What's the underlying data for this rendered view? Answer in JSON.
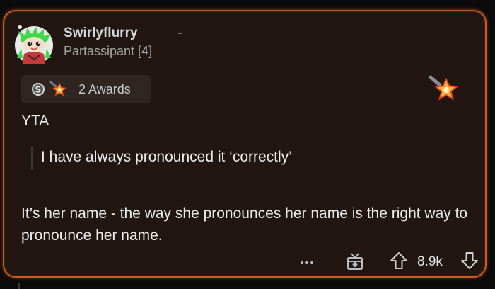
{
  "comment": {
    "username": "Swirlyflurry",
    "flair": "Partassipant [4]",
    "awards_label": "2 Awards",
    "verdict": "YTA",
    "quote": "I have always pronounced it ‘correctly’",
    "body": "It’s her name - the way she pronounces her name is the right way to pronounce her name.",
    "score": "8.9k"
  },
  "icons": {
    "avatar": "snoo-avatar-green-hair",
    "silver_award": "silver-award-icon",
    "star_award": "star-award-icon",
    "more": "more-dots-icon",
    "gift": "gift-award-icon",
    "upvote": "upvote-arrow-icon",
    "downvote": "downvote-arrow-icon"
  },
  "colors": {
    "card_background": "#221612",
    "card_border": "#c95a20",
    "award_pill": "#2f2521",
    "text": "#ececec",
    "muted_text": "#a5a5a5"
  }
}
